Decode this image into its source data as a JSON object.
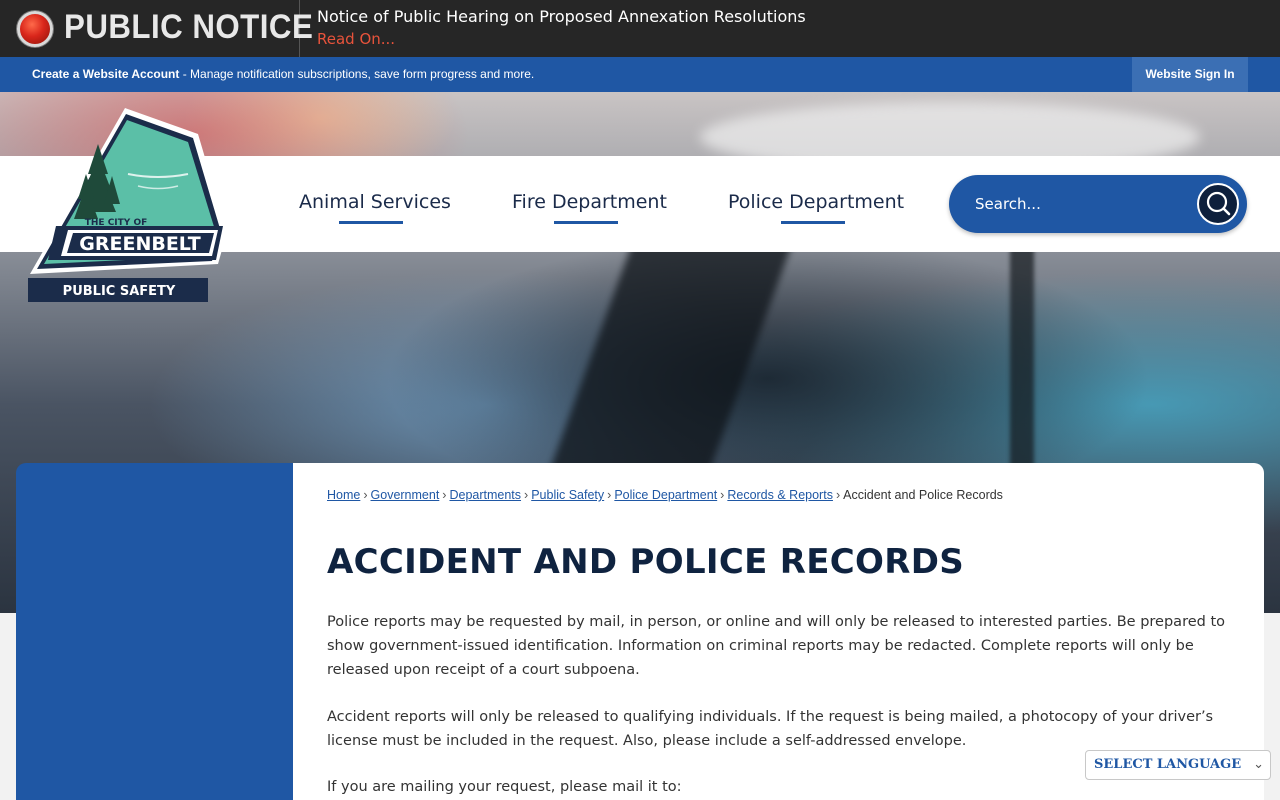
{
  "alert": {
    "label": "PUBLIC NOTICE",
    "headline": "Notice of Public Hearing on Proposed Annexation Resolutions",
    "read_more": "Read On...",
    "accent_color": "#e8533b"
  },
  "account_bar": {
    "create_link": "Create a Website Account",
    "description": " - Manage notification subscriptions, save form progress and more.",
    "sign_in": "Website Sign In"
  },
  "logo": {
    "line1": "THE CITY OF",
    "line2": "GREENBELT",
    "line3": "PUBLIC SAFETY"
  },
  "nav": {
    "items": [
      {
        "label": "Animal Services"
      },
      {
        "label": "Fire Department"
      },
      {
        "label": "Police Department"
      }
    ]
  },
  "search": {
    "placeholder": "Search...",
    "icon": "search-icon"
  },
  "breadcrumb": {
    "links": [
      "Home",
      "Government",
      "Departments",
      "Public Safety",
      "Police Department",
      "Records & Reports"
    ],
    "current": "Accident and Police Records",
    "separator": "›"
  },
  "page": {
    "title": "ACCIDENT AND POLICE RECORDS",
    "paragraphs": [
      "Police reports may be requested by mail, in person, or online and will only be released to interested parties. Be prepared to show government-issued identification. Information on criminal reports may be redacted. Complete reports will only be released upon receipt of a court subpoena.",
      "Accident reports will only be released to qualifying individuals. If the request is being mailed, a photocopy of your driver’s license must be included in the request. Also, please include a self-addressed envelope.",
      "If you are mailing your request, please mail it to:"
    ]
  },
  "language": {
    "selected": "SELECT LANGUAGE"
  },
  "colors": {
    "brand_blue": "#1f57a4",
    "dark_navy": "#0f2340",
    "alert_bg": "#262626"
  }
}
